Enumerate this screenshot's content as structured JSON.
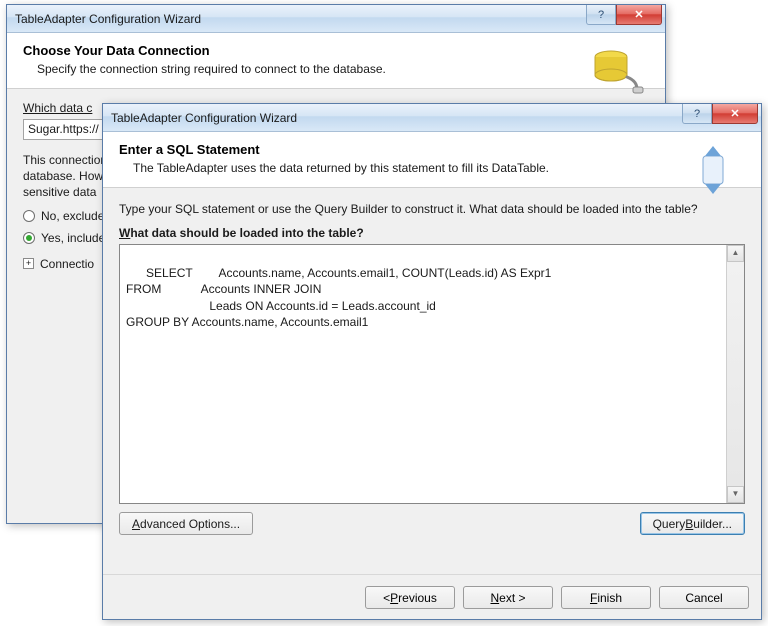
{
  "back": {
    "title": "TableAdapter Configuration Wizard",
    "banner_title": "Choose Your Data Connection",
    "banner_sub": "Specify the connection string required to connect to the database.",
    "conn_label_prefix": "Which data c",
    "conn_value": "Sugar.https://",
    "para": "This connection\ndatabase. How\nsensitive data",
    "radio_no": "No, exclude",
    "radio_yes": "Yes, include",
    "expander_label": "Connectio"
  },
  "front": {
    "title": "TableAdapter Configuration Wizard",
    "banner_title": "Enter a SQL Statement",
    "banner_sub": "The TableAdapter uses the data returned by this statement to fill its DataTable.",
    "instruction": "Type your SQL statement or use the Query Builder to construct it. What data should be loaded into the table?",
    "field_label_prefix_u": "W",
    "field_label_rest": "hat data should be loaded into the table?",
    "sql": "SELECT        Accounts.name, Accounts.email1, COUNT(Leads.id) AS Expr1\nFROM            Accounts INNER JOIN\n                         Leads ON Accounts.id = Leads.account_id\nGROUP BY Accounts.name, Accounts.email1",
    "advanced_u": "A",
    "advanced_rest": "dvanced Options...",
    "qb_prefix": "Query ",
    "qb_u": "B",
    "qb_rest": "uilder...",
    "prev_prefix": "< ",
    "prev_u": "P",
    "prev_rest": "revious",
    "next_u": "N",
    "next_rest": "ext >",
    "finish_u": "F",
    "finish_rest": "inish",
    "cancel": "Cancel"
  }
}
